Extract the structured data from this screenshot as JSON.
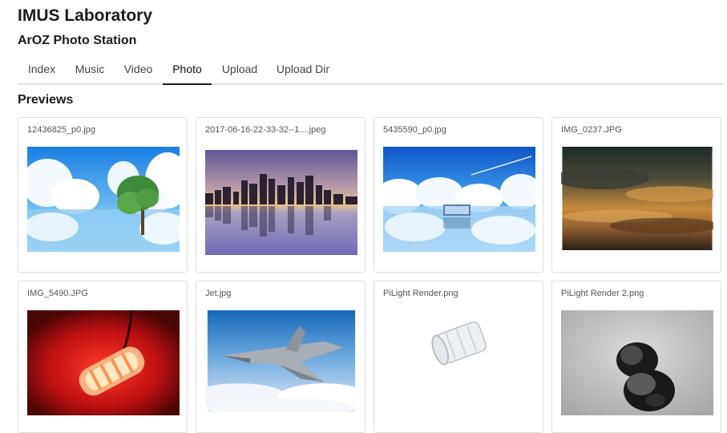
{
  "app": {
    "title": "IMUS Laboratory",
    "subtitle": "ArOZ Photo Station"
  },
  "tabs": [
    {
      "label": "Index"
    },
    {
      "label": "Music"
    },
    {
      "label": "Video"
    },
    {
      "label": "Photo",
      "active": true
    },
    {
      "label": "Upload"
    },
    {
      "label": "Upload Dir"
    }
  ],
  "previews": {
    "heading": "Previews",
    "items": [
      {
        "name": "12436825_p0.jpg",
        "subject": "anime sky with clouds and tree"
      },
      {
        "name": "2017-06-16-22-33-32--1....jpeg",
        "subject": "city skyline reflected on water"
      },
      {
        "name": "5435590_p0.jpg",
        "subject": "clouds over water with small station"
      },
      {
        "name": "IMG_0237.JPG",
        "subject": "sunset clouds"
      },
      {
        "name": "IMG_5490.JPG",
        "subject": "red glowing lamp"
      },
      {
        "name": "Jet.jpg",
        "subject": "fighter jet above clouds"
      },
      {
        "name": "PiLight Render.png",
        "subject": "transparent cylinder render"
      },
      {
        "name": "PiLight Render 2.png",
        "subject": "black cylinders render"
      }
    ]
  },
  "colors": {
    "accent": "#1b1c1d",
    "tab_underline": "#e0e0e0",
    "card_border": "#dededf"
  }
}
